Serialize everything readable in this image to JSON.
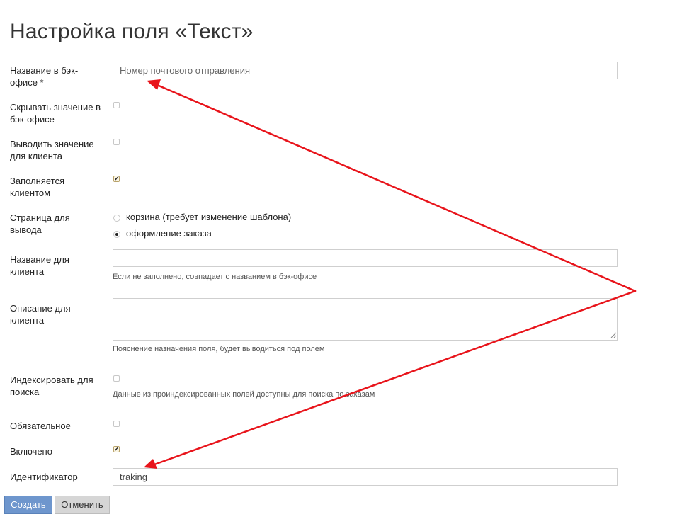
{
  "page": {
    "title": "Настройка поля «Текст»"
  },
  "form": {
    "backoffice_name": {
      "label": "Название в бэк-офисе *",
      "value": "",
      "placeholder": "Номер почтового отправления"
    },
    "hide_in_backoffice": {
      "label": "Скрывать значение в бэк-офисе",
      "checked": false
    },
    "show_to_client": {
      "label": "Выводить значение для клиента",
      "checked": false
    },
    "filled_by_client": {
      "label": "Заполняется клиентом",
      "checked": true
    },
    "output_page": {
      "label": "Страница для вывода",
      "options": [
        {
          "label": "корзина (требует изменение шаблона)",
          "selected": false
        },
        {
          "label": "оформление заказа",
          "selected": true
        }
      ]
    },
    "client_name": {
      "label": "Название для клиента",
      "value": "",
      "hint": "Если не заполнено, совпадает с названием в бэк-офисе"
    },
    "client_description": {
      "label": "Описание для клиента",
      "value": "",
      "hint": "Пояснение назначения поля, будет выводиться под полем"
    },
    "index_for_search": {
      "label": "Индексировать для поиска",
      "checked": false,
      "hint": "Данные из проиндексированных полей доступны для поиска по заказам"
    },
    "required": {
      "label": "Обязательное",
      "checked": false
    },
    "enabled": {
      "label": "Включено",
      "checked": true
    },
    "identifier": {
      "label": "Идентификатор",
      "value": "traking"
    }
  },
  "actions": {
    "create_label": "Создать",
    "cancel_label": "Отменить"
  },
  "annotation": {
    "arrow_color": "#e8141b"
  }
}
